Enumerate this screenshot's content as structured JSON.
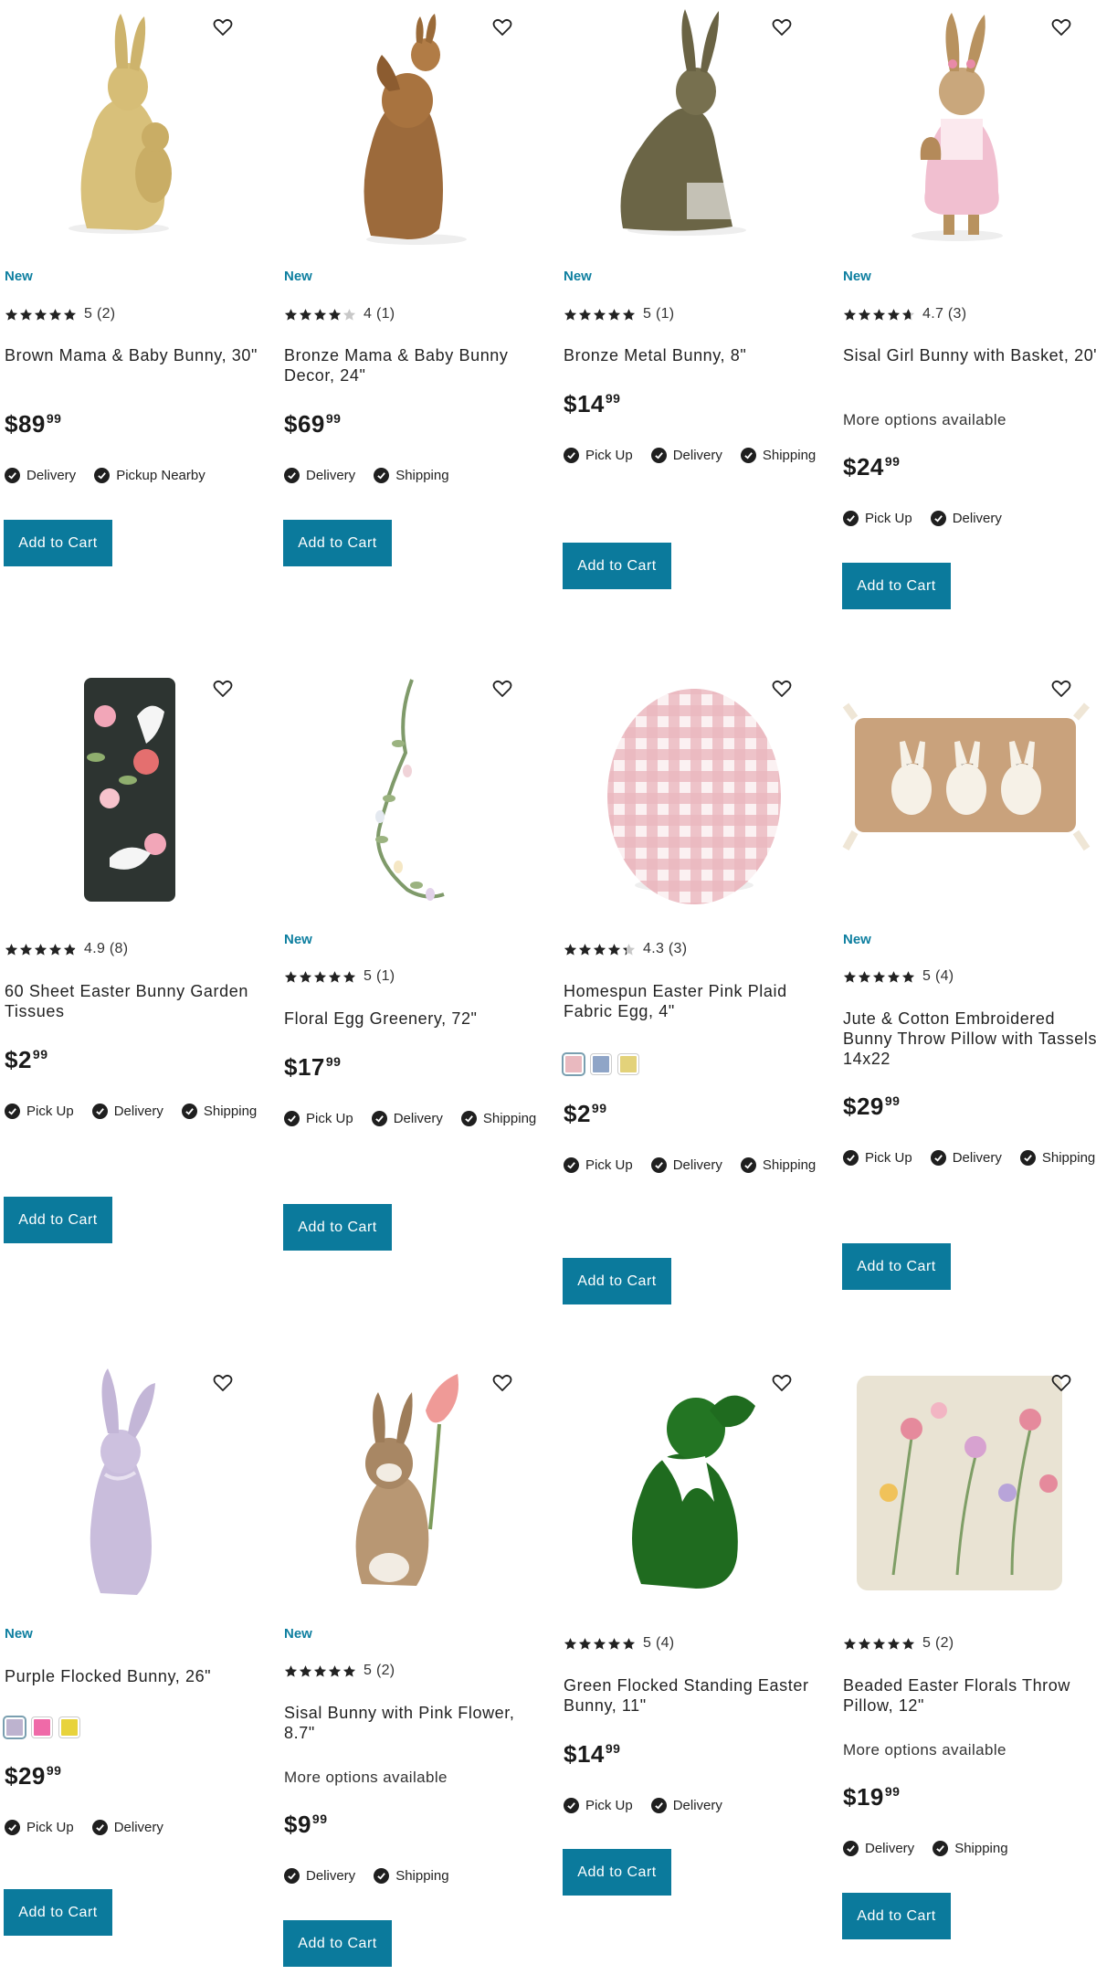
{
  "colors": {
    "accent": "#0b7a9c",
    "new_badge": "#0e7fa0"
  },
  "products": [
    {
      "name": "Brown Mama & Baby Bunny, 30\"",
      "badge": "New",
      "rating_text": "5 (2)",
      "stars": 5,
      "price_dollars": "$89",
      "price_cents": "99",
      "fulfillment": [
        "Delivery",
        "Pickup Nearby"
      ],
      "cta": "Add to Cart",
      "wishlist_icon": "heart-icon"
    },
    {
      "name": "Bronze Mama & Baby Bunny Decor, 24\"",
      "badge": "New",
      "rating_text": "4 (1)",
      "stars": 4,
      "price_dollars": "$69",
      "price_cents": "99",
      "fulfillment": [
        "Delivery",
        "Shipping"
      ],
      "cta": "Add to Cart",
      "wishlist_icon": "heart-icon"
    },
    {
      "name": "Bronze Metal Bunny, 8\"",
      "badge": "New",
      "rating_text": "5 (1)",
      "stars": 5,
      "price_dollars": "$14",
      "price_cents": "99",
      "fulfillment": [
        "Pick Up",
        "Delivery",
        "Shipping"
      ],
      "cta": "Add to Cart",
      "wishlist_icon": "heart-icon"
    },
    {
      "name": "Sisal Girl Bunny with Basket, 20\"",
      "badge": "New",
      "rating_text": "4.7 (3)",
      "stars": 4.7,
      "more_options": "More options available",
      "price_dollars": "$24",
      "price_cents": "99",
      "fulfillment": [
        "Pick Up",
        "Delivery"
      ],
      "cta": "Add to Cart",
      "wishlist_icon": "heart-icon"
    },
    {
      "name": "60 Sheet Easter Bunny Garden Tissues",
      "rating_text": "4.9 (8)",
      "stars": 4.9,
      "price_dollars": "$2",
      "price_cents": "99",
      "fulfillment": [
        "Pick Up",
        "Delivery",
        "Shipping"
      ],
      "cta": "Add to Cart",
      "wishlist_icon": "heart-icon"
    },
    {
      "name": "Floral Egg Greenery, 72\"",
      "badge": "New",
      "rating_text": "5 (1)",
      "stars": 5,
      "price_dollars": "$17",
      "price_cents": "99",
      "fulfillment": [
        "Pick Up",
        "Delivery",
        "Shipping"
      ],
      "cta": "Add to Cart",
      "wishlist_icon": "heart-icon"
    },
    {
      "name": "Homespun Easter Pink Plaid Fabric Egg, 4\"",
      "rating_text": "4.3 (3)",
      "stars": 4.3,
      "swatches": [
        "#e9b9bf",
        "#8fa5c7",
        "#e3d27a"
      ],
      "price_dollars": "$2",
      "price_cents": "99",
      "fulfillment": [
        "Pick Up",
        "Delivery",
        "Shipping"
      ],
      "cta": "Add to Cart",
      "wishlist_icon": "heart-icon"
    },
    {
      "name": "Jute & Cotton Embroidered Bunny Throw Pillow with Tassels, 14x22",
      "badge": "New",
      "rating_text": "5 (4)",
      "stars": 5,
      "price_dollars": "$29",
      "price_cents": "99",
      "fulfillment": [
        "Pick Up",
        "Delivery",
        "Shipping"
      ],
      "cta": "Add to Cart",
      "wishlist_icon": "heart-icon"
    },
    {
      "name": "Purple Flocked Bunny, 26\"",
      "badge": "New",
      "swatches": [
        "#bdb3cf",
        "#ef6aa8",
        "#e8d33c"
      ],
      "price_dollars": "$29",
      "price_cents": "99",
      "fulfillment": [
        "Pick Up",
        "Delivery"
      ],
      "cta": "Add to Cart",
      "wishlist_icon": "heart-icon"
    },
    {
      "name": "Sisal Bunny with Pink Flower, 8.7\"",
      "badge": "New",
      "rating_text": "5 (2)",
      "stars": 5,
      "more_options": "More options available",
      "price_dollars": "$9",
      "price_cents": "99",
      "fulfillment": [
        "Delivery",
        "Shipping"
      ],
      "cta": "Add to Cart",
      "wishlist_icon": "heart-icon"
    },
    {
      "name": "Green Flocked Standing Easter Bunny, 11\"",
      "rating_text": "5 (4)",
      "stars": 5,
      "price_dollars": "$14",
      "price_cents": "99",
      "fulfillment": [
        "Pick Up",
        "Delivery"
      ],
      "cta": "Add to Cart",
      "wishlist_icon": "heart-icon"
    },
    {
      "name": "Beaded Easter Florals Throw Pillow, 12\"",
      "rating_text": "5 (2)",
      "stars": 5,
      "more_options": "More options available",
      "price_dollars": "$19",
      "price_cents": "99",
      "fulfillment": [
        "Delivery",
        "Shipping"
      ],
      "cta": "Add to Cart",
      "wishlist_icon": "heart-icon"
    }
  ]
}
